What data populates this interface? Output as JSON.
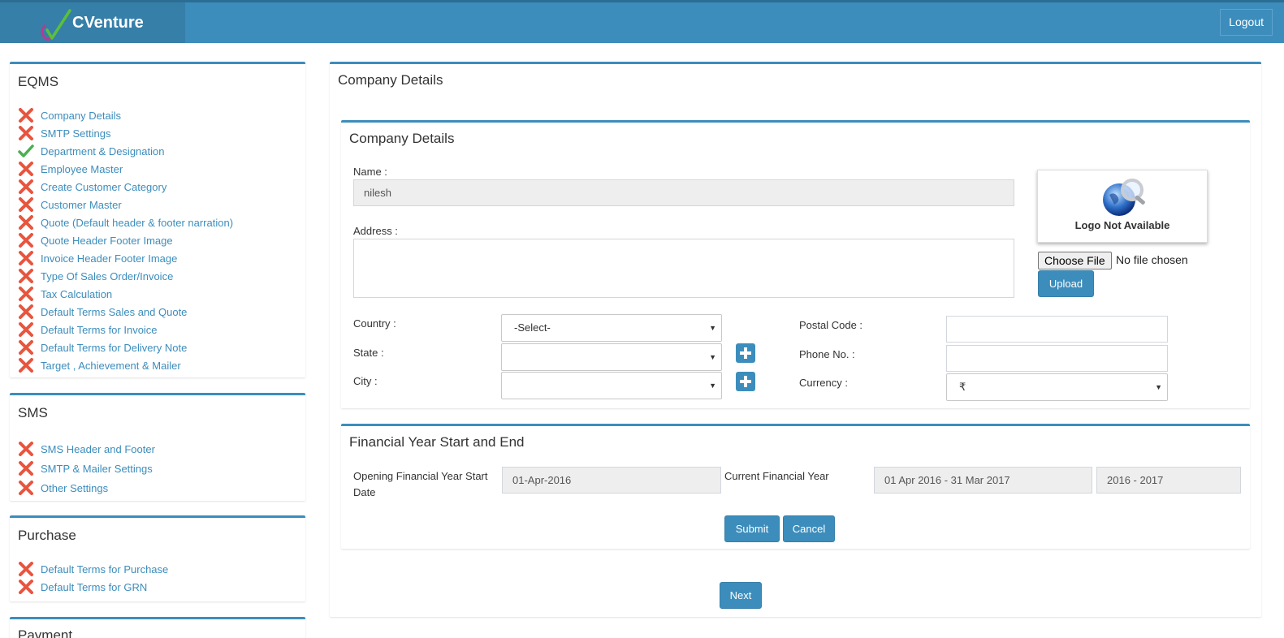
{
  "header": {
    "brand": "CVenture",
    "logout_label": "Logout"
  },
  "sidebar": {
    "eqms": {
      "title": "EQMS",
      "items": [
        {
          "label": "Company Details",
          "status": "pending"
        },
        {
          "label": "SMTP Settings",
          "status": "pending"
        },
        {
          "label": "Department & Designation",
          "status": "done"
        },
        {
          "label": "Employee Master",
          "status": "pending"
        },
        {
          "label": "Create Customer Category",
          "status": "pending"
        },
        {
          "label": "Customer Master",
          "status": "pending"
        },
        {
          "label": "Quote (Default header & footer narration)",
          "status": "pending"
        },
        {
          "label": "Quote Header Footer Image",
          "status": "pending"
        },
        {
          "label": "Invoice Header Footer Image",
          "status": "pending"
        },
        {
          "label": "Type Of Sales Order/Invoice",
          "status": "pending"
        },
        {
          "label": "Tax Calculation",
          "status": "pending"
        },
        {
          "label": "Default Terms Sales and Quote",
          "status": "pending"
        },
        {
          "label": "Default Terms for Invoice",
          "status": "pending"
        },
        {
          "label": "Default Terms for Delivery Note",
          "status": "pending"
        },
        {
          "label": "Target , Achievement & Mailer",
          "status": "pending"
        }
      ]
    },
    "sms": {
      "title": "SMS",
      "items": [
        {
          "label": "SMS Header and Footer",
          "status": "pending"
        },
        {
          "label": "SMTP & Mailer Settings",
          "status": "pending"
        },
        {
          "label": "Other Settings",
          "status": "pending"
        }
      ]
    },
    "purchase": {
      "title": "Purchase",
      "items": [
        {
          "label": "Default Terms for Purchase",
          "status": "pending"
        },
        {
          "label": "Default Terms for GRN",
          "status": "pending"
        }
      ]
    },
    "payment": {
      "title": "Payment"
    }
  },
  "main": {
    "title": "Company Details",
    "company_section": {
      "title": "Company Details",
      "name_label": "Name :",
      "name_value": "nilesh",
      "address_label": "Address :",
      "address_value": "",
      "country_label": "Country :",
      "country_value": "-Select-",
      "state_label": "State :",
      "state_value": "",
      "city_label": "City :",
      "city_value": "",
      "postal_label": "Postal Code :",
      "postal_value": "",
      "phone_label": "Phone No. :",
      "phone_value": "",
      "currency_label": "Currency :",
      "currency_value": "₹",
      "logo_text": "Logo Not Available",
      "choose_file_label": "Choose File",
      "no_file_text": "No file chosen",
      "upload_label": "Upload"
    },
    "financial_section": {
      "title": "Financial Year Start and End",
      "opening_label": "Opening Financial Year Start Date",
      "opening_value": "01-Apr-2016",
      "current_label": "Current Financial Year",
      "current_range": "01 Apr 2016 - 31 Mar 2017",
      "current_short": "2016 - 2017",
      "submit_label": "Submit",
      "cancel_label": "Cancel"
    },
    "next_label": "Next"
  },
  "colors": {
    "primary": "#3c8dbc",
    "brand_dark": "#367fa9",
    "cross": "#e8553e",
    "check": "#4caf50"
  }
}
